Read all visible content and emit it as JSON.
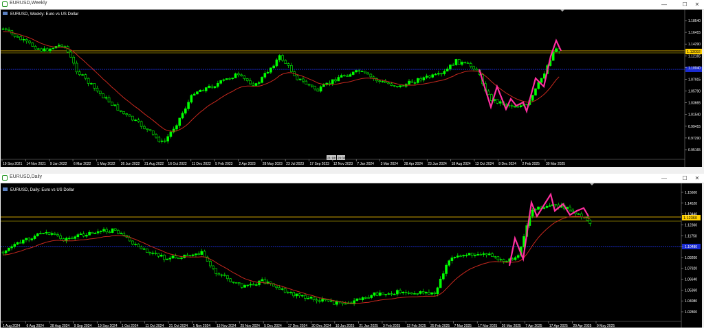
{
  "top_window": {
    "title": "EURUSD,Weekly",
    "chart_label": "EURUSD, Weekly:  Euro vs US Dollar",
    "price_ticks": [
      "1.18540",
      "1.16415",
      "1.14290",
      "1.12165",
      "1.10040",
      "1.07915",
      "1.05790",
      "1.03665",
      "1.01540",
      "0.99415",
      "0.97290",
      "0.95165"
    ],
    "current_price": "1.13092",
    "date_labels": [
      "19 Sep 2021",
      "14 Nov 2021",
      "9 Jan 2022",
      "6 Mar 2022",
      "1 May 2022",
      "26 Jun 2022",
      "21 Aug 2022",
      "16 Oct 2022",
      "11 Dec 2022",
      "5 Feb 2023",
      "2 Apr 2023",
      "28 May 2023",
      "23 Jul 2023",
      "17 Sep 2023",
      "12 Nov 2023",
      "7 Jan 2024",
      "3 Mar 2024",
      "28 Apr 2024",
      "23 Jun 2024",
      "18 Aug 2024",
      "13 Oct 2024",
      "8 Dec 2024",
      "2 Feb 2025",
      "30 Mar 2025"
    ],
    "crosshair_labels": [
      "21:18:00",
      "29:30"
    ]
  },
  "bottom_window": {
    "title": "EURUSD,Daily",
    "chart_label": "EURUSD, Daily:  Euro vs US Dollar",
    "price_ticks": [
      "1.15600",
      "1.14520",
      "1.13440",
      "1.12360",
      "1.11750",
      "1.10480",
      "1.09200",
      "1.07920",
      "1.06640",
      "1.05360",
      "1.04080",
      "1.02800"
    ],
    "current_price": "1.12360",
    "date_labels": [
      "1 Aug 2024",
      "6 Aug 2024",
      "28 Aug 2024",
      "9 Sep 2024",
      "19 Sep 2024",
      "1 Oct 2024",
      "11 Oct 2024",
      "21 Oct 2024",
      "1 Nov 2024",
      "13 Nov 2024",
      "25 Nov 2024",
      "5 Dec 2024",
      "17 Dec 2024",
      "30 Dec 2024",
      "10 Jan 2025",
      "21 Jan 2025",
      "3 Feb 2025",
      "12 Feb 2025",
      "25 Feb 2025",
      "7 Mar 2025",
      "17 Mar 2025",
      "26 Mar 2025",
      "7 Apr 2025",
      "17 Apr 2025",
      "29 Apr 2025",
      "9 May 2025"
    ]
  },
  "window_controls": {
    "minimize": "—",
    "maximize": "☐",
    "close": "✕"
  },
  "colors": {
    "candle": "#00ff00",
    "ma": "#c8281e",
    "zigzag": "#ff2fa0",
    "level_gold": "#c8a000",
    "level_blue": "#1a2bd0",
    "current_price_bg": "#ffd000"
  }
}
